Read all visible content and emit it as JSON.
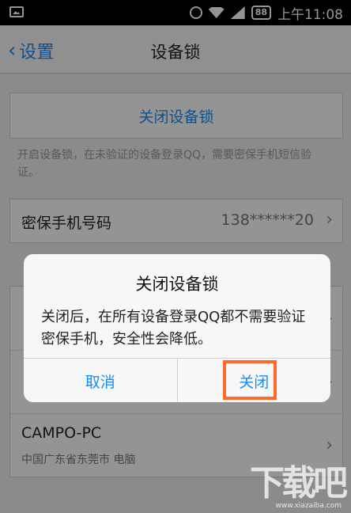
{
  "status_bar": {
    "battery": "88",
    "time": "上午11:08"
  },
  "nav": {
    "back_label": "设置",
    "title": "设备锁"
  },
  "lock": {
    "close_button_label": "关闭设备锁",
    "description": "开启设备锁，在未验证的设备登录QQ，需要密保手机短信验证。"
  },
  "phone_row": {
    "label": "密保手机号码",
    "value": "138******20"
  },
  "devices": [
    {
      "name": "",
      "location": ""
    },
    {
      "name": "",
      "location": ""
    },
    {
      "name": "CAMPO-PC",
      "location": "中国广东省东莞市 电脑"
    }
  ],
  "dialog": {
    "title": "关闭设备锁",
    "message": "关闭后，在所有设备登录QQ都不需要验证密保手机，安全性会降低。",
    "cancel_label": "取消",
    "confirm_label": "关闭"
  },
  "watermark": {
    "text": "下载吧",
    "url": "www.xiazaiba.com"
  },
  "colors": {
    "accent": "#1b8bf5",
    "highlight": "#ff6a2b"
  }
}
